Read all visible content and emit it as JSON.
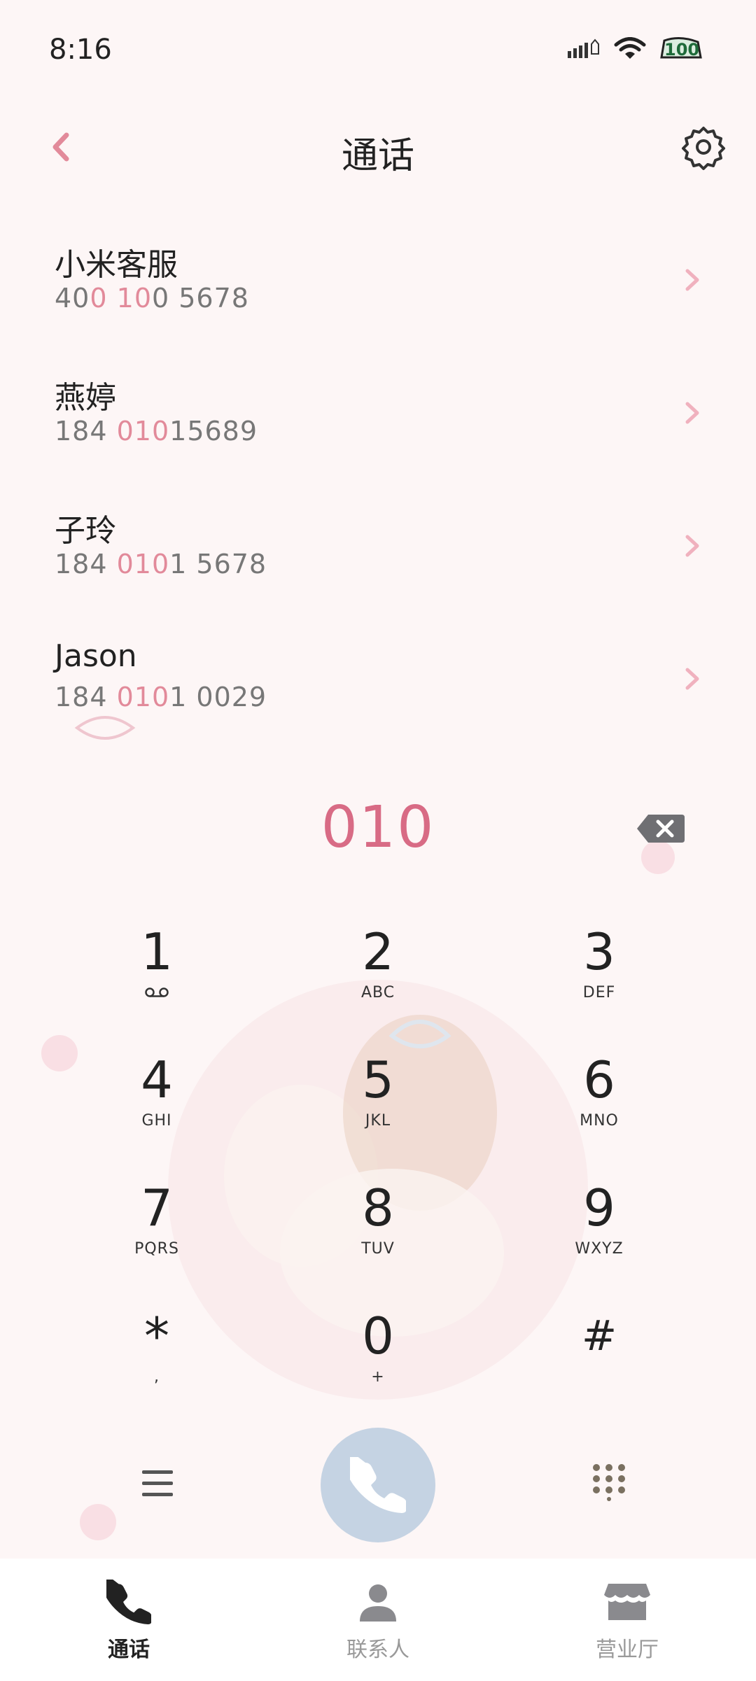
{
  "status_bar": {
    "time": "8:16",
    "battery": "100"
  },
  "header": {
    "title": "通话"
  },
  "results": [
    {
      "name": "小米客服",
      "number_parts": [
        {
          "t": "40",
          "h": false
        },
        {
          "t": "0",
          "h": true
        },
        {
          "t": " ",
          "h": false
        },
        {
          "t": "10",
          "h": true
        },
        {
          "t": "0 5678",
          "h": false
        }
      ]
    },
    {
      "name": "燕婷",
      "number_parts": [
        {
          "t": "184 ",
          "h": false
        },
        {
          "t": "010",
          "h": true
        },
        {
          "t": "15689",
          "h": false
        }
      ]
    },
    {
      "name": "子玲",
      "number_parts": [
        {
          "t": "184 ",
          "h": false
        },
        {
          "t": "010",
          "h": true
        },
        {
          "t": "1 5678",
          "h": false
        }
      ]
    },
    {
      "name": "Jason",
      "number_parts": [
        {
          "t": "184 ",
          "h": false
        },
        {
          "t": "010",
          "h": true
        },
        {
          "t": "1 0029",
          "h": false
        }
      ]
    }
  ],
  "dialer": {
    "typed": "010",
    "keys": [
      {
        "digit": "1",
        "letters": ""
      },
      {
        "digit": "2",
        "letters": "ABC"
      },
      {
        "digit": "3",
        "letters": "DEF"
      },
      {
        "digit": "4",
        "letters": "GHI"
      },
      {
        "digit": "5",
        "letters": "JKL"
      },
      {
        "digit": "6",
        "letters": "MNO"
      },
      {
        "digit": "7",
        "letters": "PQRS"
      },
      {
        "digit": "8",
        "letters": "TUV"
      },
      {
        "digit": "9",
        "letters": "WXYZ"
      },
      {
        "digit": "*",
        "letters": ","
      },
      {
        "digit": "0",
        "letters": "+"
      },
      {
        "digit": "#",
        "letters": ""
      }
    ]
  },
  "tabs": [
    {
      "label": "通话",
      "icon": "phone-icon",
      "active": true
    },
    {
      "label": "联系人",
      "icon": "person-icon",
      "active": false
    },
    {
      "label": "营业厅",
      "icon": "store-icon",
      "active": false
    }
  ],
  "colors": {
    "accent": "#d86b85",
    "highlight": "#e28a9a",
    "call_button": "#c5d3e3",
    "background": "#fdf6f6"
  }
}
